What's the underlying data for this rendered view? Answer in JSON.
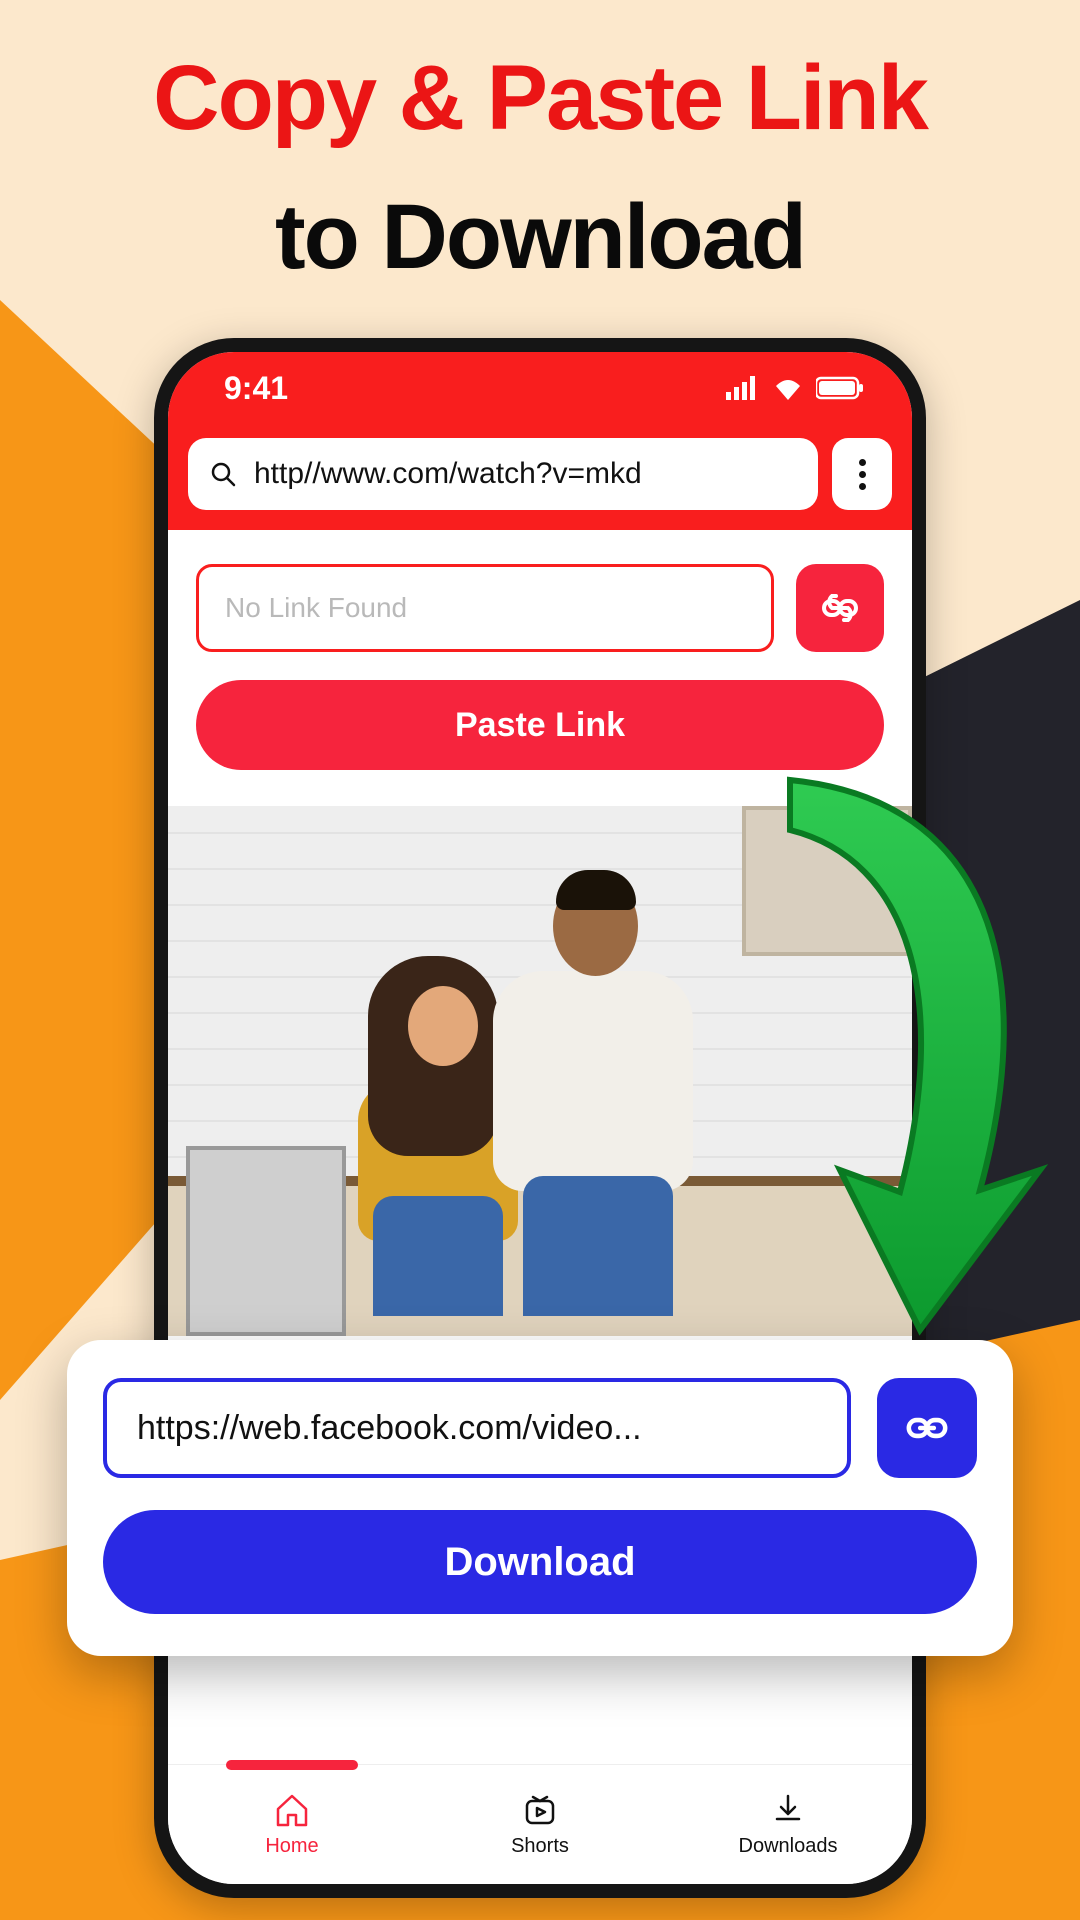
{
  "headline": {
    "line1": "Copy & Paste Link",
    "line2": "to Download"
  },
  "statusbar": {
    "time": "9:41"
  },
  "urlbar": {
    "url": "http//www.com/watch?v=mkd"
  },
  "linkInput": {
    "placeholder": "No Link Found"
  },
  "pasteButton": {
    "label": "Paste Link"
  },
  "downloadCard": {
    "url": "https://web.facebook.com/video...",
    "button": "Download"
  },
  "nav": {
    "items": [
      {
        "label": "Home"
      },
      {
        "label": "Shorts"
      },
      {
        "label": "Downloads"
      }
    ]
  },
  "colors": {
    "primaryRed": "#F91E1E",
    "accentRed": "#F6243D",
    "blue": "#2A29E4",
    "green": "#1BAF3E",
    "orange": "#F79617"
  }
}
